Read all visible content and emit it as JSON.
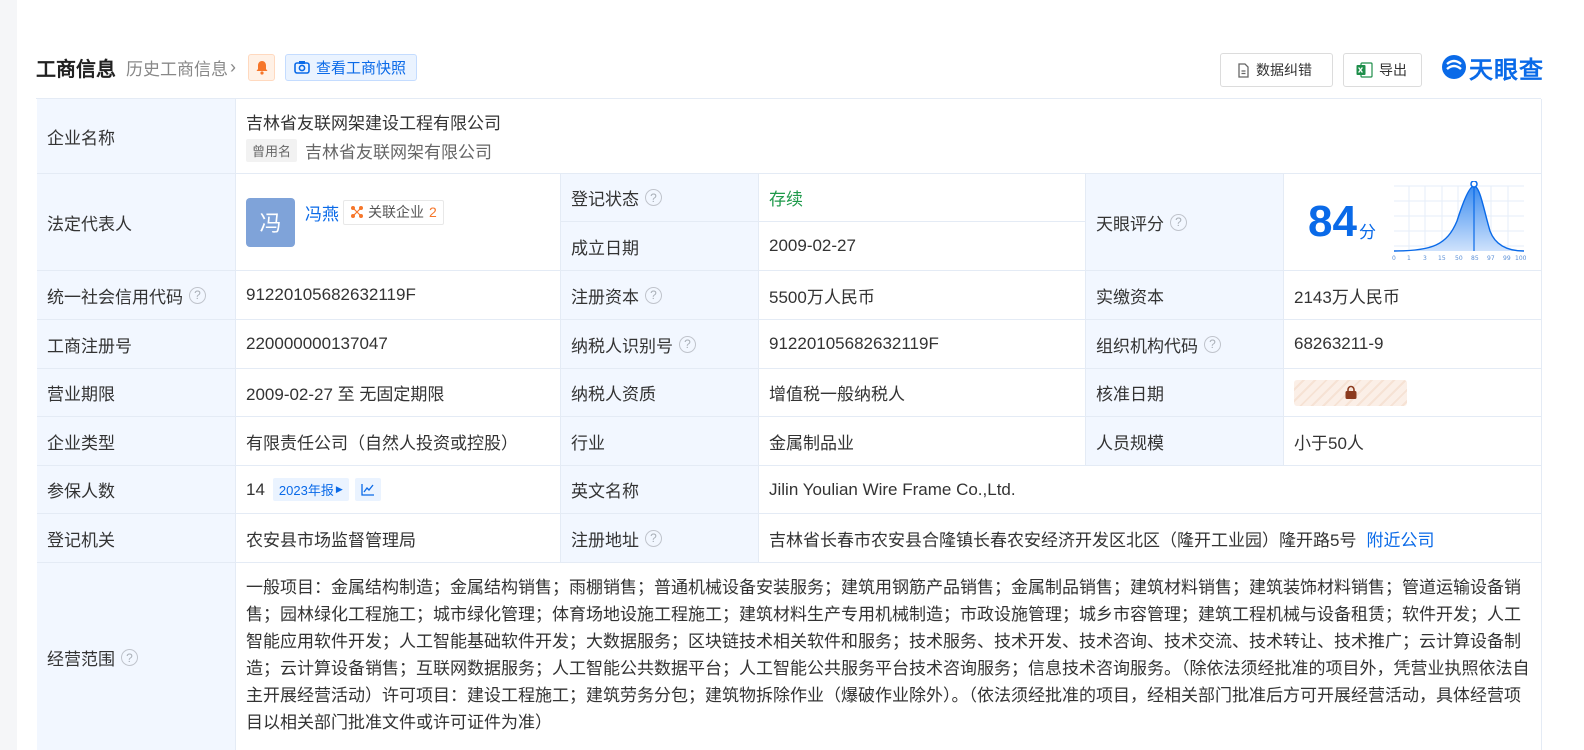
{
  "header": {
    "title": "工商信息",
    "history_link": "历史工商信息",
    "snapshot_button": "查看工商快照",
    "correct_button": "数据纠错",
    "export_button": "导出",
    "logo": "天眼查",
    "icons": [
      "bell-icon",
      "camera-icon",
      "document-icon",
      "excel-icon",
      "tianyancha-logo"
    ]
  },
  "rows": {
    "company_name": {
      "label": "企业名称",
      "value": "吉林省友联网架建设工程有限公司",
      "former_tag": "曾用名",
      "former_name": "吉林省友联网架有限公司"
    },
    "legal_rep": {
      "label": "法定代表人",
      "avatar": "冯",
      "name": "冯燕",
      "related_label": "关联企业",
      "related_count": "2"
    },
    "reg_status": {
      "label": "登记状态",
      "value": "存续"
    },
    "established": {
      "label": "成立日期",
      "value": "2009-02-27"
    },
    "tianyan_score": {
      "label": "天眼评分",
      "score": "84",
      "unit": "分",
      "axis_ticks": [
        "0",
        "1",
        "3",
        "15",
        "50",
        "85",
        "97",
        "99",
        "100"
      ]
    },
    "credit_code": {
      "label": "统一社会信用代码",
      "value": "91220105682632119F"
    },
    "reg_capital": {
      "label": "注册资本",
      "value": "5500万人民币"
    },
    "paid_capital": {
      "label": "实缴资本",
      "value": "2143万人民币"
    },
    "reg_number": {
      "label": "工商注册号",
      "value": "220000000137047"
    },
    "taxpayer_id": {
      "label": "纳税人识别号",
      "value": "91220105682632119F"
    },
    "org_code": {
      "label": "组织机构代码",
      "value": "68263211-9"
    },
    "business_term": {
      "label": "营业期限",
      "value": "2009-02-27 至 无固定期限"
    },
    "taxpayer_type": {
      "label": "纳税人资质",
      "value": "增值税一般纳税人"
    },
    "approval_date": {
      "label": "核准日期"
    },
    "company_type": {
      "label": "企业类型",
      "value": "有限责任公司（自然人投资或控股）"
    },
    "industry": {
      "label": "行业",
      "value": "金属制品业"
    },
    "staff_size": {
      "label": "人员规模",
      "value": "小于50人"
    },
    "insured": {
      "label": "参保人数",
      "value": "14",
      "year_tag": "2023年报"
    },
    "english_name": {
      "label": "英文名称",
      "value": "Jilin Youlian Wire Frame Co.,Ltd."
    },
    "authority": {
      "label": "登记机关",
      "value": "农安县市场监督管理局"
    },
    "address": {
      "label": "注册地址",
      "value": "吉林省长春市农安县合隆镇长春农安经济开发区北区（隆开工业园）隆开路5号",
      "link": "附近公司"
    },
    "scope": {
      "label": "经营范围",
      "value": "一般项目：金属结构制造；金属结构销售；雨棚销售；普通机械设备安装服务；建筑用钢筋产品销售；金属制品销售；建筑材料销售；建筑装饰材料销售；管道运输设备销售；园林绿化工程施工；城市绿化管理；体育场地设施工程施工；建筑材料生产专用机械制造；市政设施管理；城乡市容管理；建筑工程机械与设备租赁；软件开发；人工智能应用软件开发；人工智能基础软件开发；大数据服务；区块链技术相关软件和服务；技术服务、技术开发、技术咨询、技术交流、技术转让、技术推广；云计算设备制造；云计算设备销售；互联网数据服务；人工智能公共数据平台；人工智能公共服务平台技术咨询服务；信息技术咨询服务。（除依法须经批准的项目外，凭营业执照依法自主开展经营活动）许可项目：建设工程施工；建筑劳务分包；建筑物拆除作业（爆破作业除外）。（依法须经批准的项目，经相关部门批准后方可开展经营活动，具体经营项目以相关部门批准文件或许可证件为准）"
    }
  }
}
